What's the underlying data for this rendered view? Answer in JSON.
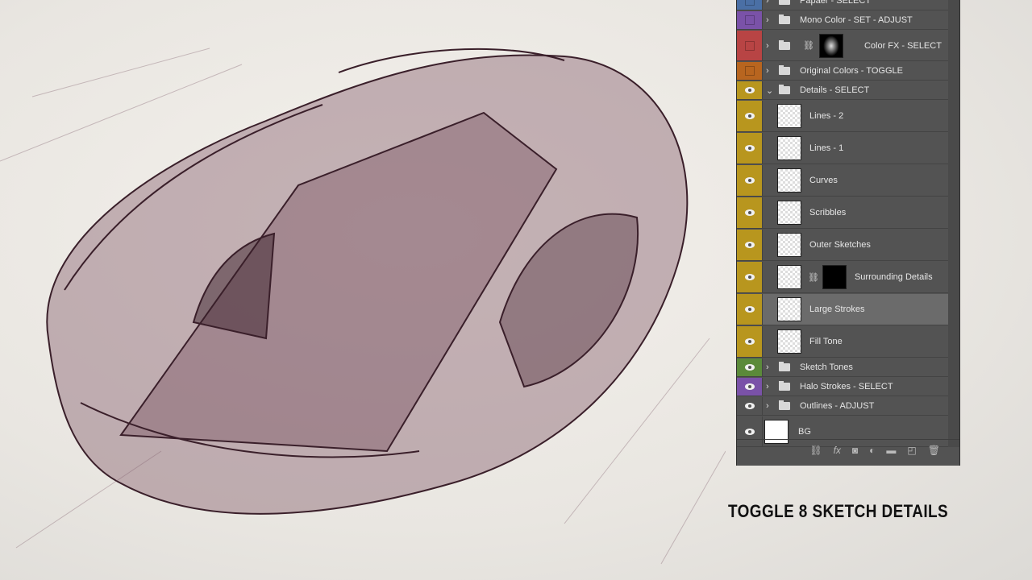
{
  "caption": "TOGGLE 8 SKETCH DETAILS",
  "layers": [
    {
      "name": "Papaer - SELECT",
      "type": "group",
      "color": "#4a6fa5",
      "visible": false
    },
    {
      "name": "Mono Color - SET - ADJUST",
      "type": "group",
      "color": "#7a52a8",
      "visible": false
    },
    {
      "name": "Color FX - SELECT",
      "type": "group-mask",
      "color": "#b84444",
      "visible": false
    },
    {
      "name": "Original Colors - TOGGLE",
      "type": "group",
      "color": "#b8651f",
      "visible": false
    },
    {
      "name": "Details - SELECT",
      "type": "group-open",
      "color": "#b8961e",
      "visible": true
    },
    {
      "name": "Lines - 2",
      "type": "layer",
      "color": "#b8961e",
      "visible": true
    },
    {
      "name": "Lines - 1",
      "type": "layer",
      "color": "#b8961e",
      "visible": true
    },
    {
      "name": "Curves",
      "type": "layer",
      "color": "#b8961e",
      "visible": true
    },
    {
      "name": "Scribbles",
      "type": "layer",
      "color": "#b8961e",
      "visible": true
    },
    {
      "name": "Outer Sketches",
      "type": "layer",
      "color": "#b8961e",
      "visible": true
    },
    {
      "name": "Surrounding Details",
      "type": "layer-mask",
      "color": "#b8961e",
      "visible": true
    },
    {
      "name": "Large Strokes",
      "type": "layer",
      "color": "#b8961e",
      "visible": true,
      "selected": true
    },
    {
      "name": "Fill Tone",
      "type": "layer",
      "color": "#b8961e",
      "visible": true
    },
    {
      "name": "Sketch Tones",
      "type": "group",
      "color": "#5b8a3a",
      "visible": true
    },
    {
      "name": "Halo Strokes - SELECT",
      "type": "group",
      "color": "#7a52a8",
      "visible": true
    },
    {
      "name": "Outlines - ADJUST",
      "type": "group",
      "color": "",
      "visible": true
    },
    {
      "name": "BG",
      "type": "bg",
      "color": "",
      "visible": true
    }
  ],
  "footer_icons": [
    "link-icon",
    "fx-icon",
    "mask-icon",
    "adjustment-icon",
    "folder-icon",
    "new-layer-icon",
    "trash-icon"
  ]
}
